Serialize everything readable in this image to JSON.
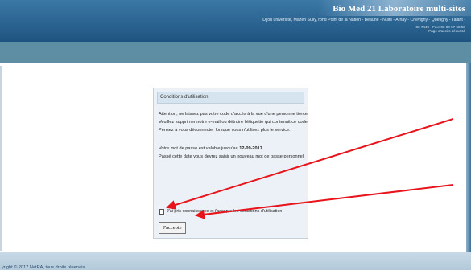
{
  "header": {
    "lab_name": "Bio Med 21 Laboratoire multi-sites",
    "address": "Dijon université, Mazen Sully, rond Point de la Nation - Beaune - Nuits - Arnay - Chevigny - Quetigny - Talant -",
    "contact_line1": "03 7449 - Fax: 03 80 57 58 58",
    "contact_line2": "Page d'accès sécurisé"
  },
  "panel": {
    "title": "Conditions d'utilisation",
    "warning_line1": "Attention, ne laissez pas votre code d'accès à la vue d'une personne tierce.",
    "warning_line2": "Veuillez supprimer notre e-mail ou détruire l'étiquette qui contenait ce code.",
    "warning_line3": "Pensez à vous déconnecter lorsque vous n'utilisez plus le service.",
    "validity_prefix": "Votre mot de passe est valable jusqu'au ",
    "validity_date": "12-09-2017",
    "validity_line2": "Passé cette date vous devrez saisir un nouveau mot de passe personnel.",
    "checkbox_label": "J'ai pris connaissance et j'accepte les conditions d'utilisation",
    "checkbox_checked": false,
    "accept_button": "J'accepte"
  },
  "footer": {
    "copyright": "yright © 2017 NetRA, tous droits réservés"
  },
  "colors": {
    "header_bar": "#2a628f",
    "sub_bar": "#5e8ea3",
    "panel_bg": "#ebf1f6",
    "annotation_arrow": "#e8141b"
  }
}
